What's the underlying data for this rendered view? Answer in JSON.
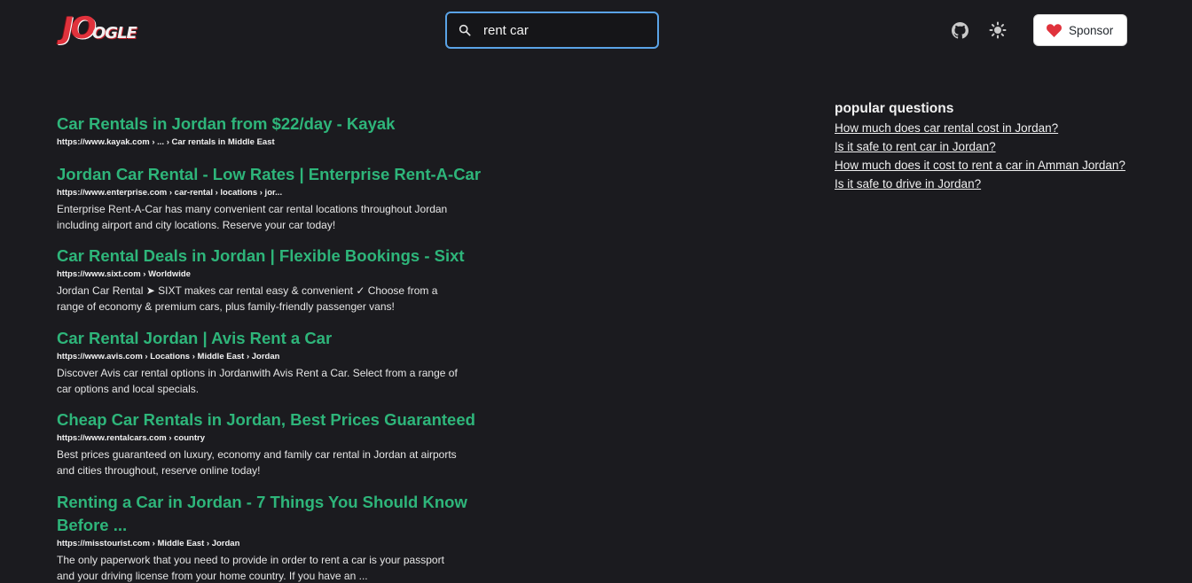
{
  "header": {
    "logo_main": "JO",
    "logo_suffix": "OGLE",
    "search": {
      "value": "rent car",
      "placeholder": ""
    },
    "sponsor_label": "Sponsor",
    "icons": [
      "github-icon",
      "sun-icon",
      "heart-icon",
      "search-icon"
    ]
  },
  "results": [
    {
      "title": "Car Rentals in Jordan from $22/day - Kayak",
      "url": "https://www.kayak.com › ... › Car rentals in Middle East",
      "snippet": ""
    },
    {
      "title": "Jordan Car Rental - Low Rates | Enterprise Rent-A-Car",
      "url": "https://www.enterprise.com › car-rental › locations › jor...",
      "snippet": "Enterprise Rent-A-Car has many convenient car rental locations throughout Jordan including airport and city locations. Reserve your car today!"
    },
    {
      "title": "Car Rental Deals in Jordan | Flexible Bookings - Sixt",
      "url": "https://www.sixt.com › Worldwide",
      "snippet": "Jordan Car Rental ➤ SIXT makes car rental easy & convenient ✓ Choose from a range of economy & premium cars, plus family-friendly passenger vans!"
    },
    {
      "title": "Car Rental Jordan | Avis Rent a Car",
      "url": "https://www.avis.com › Locations › Middle East › Jordan",
      "snippet": "Discover Avis car rental options in Jordanwith Avis Rent a Car. Select from a range of car options and local specials."
    },
    {
      "title": "Cheap Car Rentals in Jordan, Best Prices Guaranteed",
      "url": "https://www.rentalcars.com › country",
      "snippet": "Best prices guaranteed on luxury, economy and family car rental in Jordan at airports and cities throughout, reserve online today!"
    },
    {
      "title": "Renting a Car in Jordan - 7 Things You Should Know Before ...",
      "url": "https://misstourist.com › Middle East › Jordan",
      "snippet": "The only paperwork that you need to provide in order to rent a car is your passport and your driving license from your home country. If you have an ..."
    }
  ],
  "sidebar": {
    "title": "popular questions",
    "questions": [
      "How much does car rental cost in Jordan?",
      "Is it safe to rent car in Jordan?",
      "How much does it cost to rent a car in Amman Jordan?",
      "Is it safe to drive in Jordan?"
    ]
  },
  "colors": {
    "background": "#1b1b1f",
    "result_title": "#2eb57a",
    "search_border": "#5aa3e6",
    "heart": "#e0323c"
  }
}
